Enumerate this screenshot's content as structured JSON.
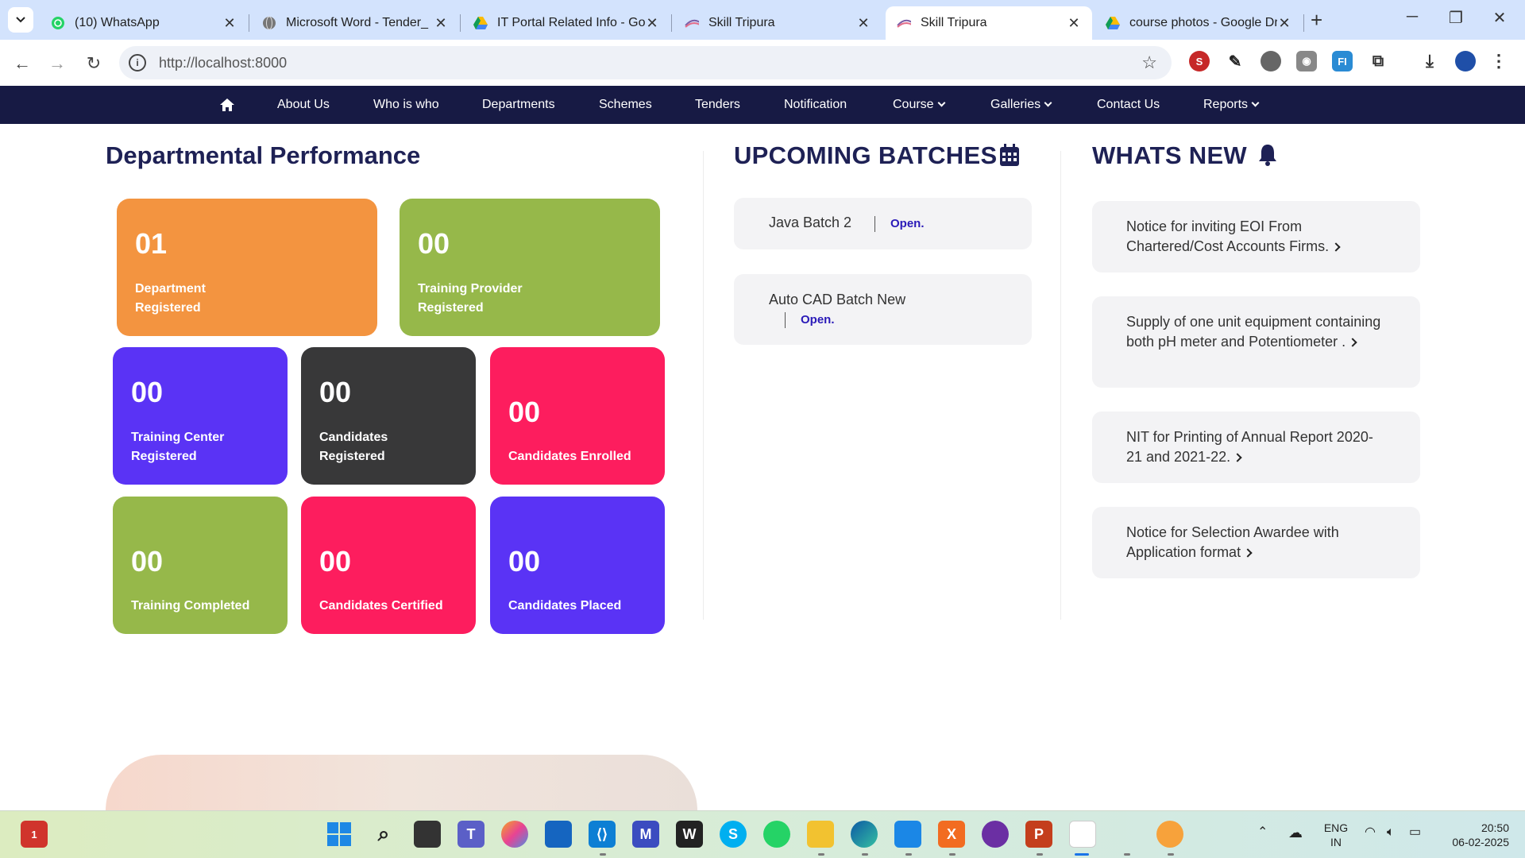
{
  "browser": {
    "tabs": [
      {
        "title": "(10) WhatsApp",
        "icon": "whatsapp-icon",
        "active": false
      },
      {
        "title": "Microsoft Word - Tender_",
        "icon": "globe-icon",
        "active": false
      },
      {
        "title": "IT Portal Related Info - Goo",
        "icon": "google-drive-icon",
        "active": false
      },
      {
        "title": "Skill Tripura",
        "icon": "skill-tripura-icon",
        "active": false
      },
      {
        "title": "Skill Tripura",
        "icon": "skill-tripura-icon",
        "active": true
      },
      {
        "title": "course photos - Google Dr",
        "icon": "google-drive-icon",
        "active": false
      }
    ],
    "url": "http://localhost:8000"
  },
  "nav": {
    "items": [
      "About Us",
      "Who is who",
      "Departments",
      "Schemes",
      "Tenders",
      "Notification",
      "Course",
      "Galleries",
      "Contact Us",
      "Reports"
    ]
  },
  "performance": {
    "title": "Departmental Performance",
    "stats": [
      {
        "num": "01",
        "label": "Department Registered",
        "color": "#f39440"
      },
      {
        "num": "00",
        "label": "Training Provider Registered",
        "color": "#96b84a"
      },
      {
        "num": "00",
        "label": "Training Center Registered",
        "color": "#5a33f5"
      },
      {
        "num": "00",
        "label": "Candidates Registered",
        "color": "#383839"
      },
      {
        "num": "00",
        "label": "Candidates Enrolled",
        "color": "#fd1d5e"
      },
      {
        "num": "00",
        "label": "Training Completed",
        "color": "#96b84a"
      },
      {
        "num": "00",
        "label": "Candidates Certified",
        "color": "#fd1d5e"
      },
      {
        "num": "00",
        "label": "Candidates Placed",
        "color": "#5a33f5"
      }
    ]
  },
  "batches": {
    "title": "UPCOMING BATCHES",
    "items": [
      {
        "name": "Java Batch 2",
        "status": "Open."
      },
      {
        "name": "Auto CAD Batch New",
        "status": "Open."
      }
    ]
  },
  "news": {
    "title": "WHATS NEW",
    "items": [
      "Notice for inviting EOI From Chartered/Cost Accounts Firms.",
      "Supply of one unit equipment containing both pH meter and Potentiometer .",
      "NIT for Printing of Annual Report 2020-21 and 2021-22.",
      "Notice for Selection Awardee with Application format"
    ]
  },
  "taskbar": {
    "badge": "1",
    "lang": "ENG",
    "region": "IN",
    "time": "20:50",
    "date": "06-02-2025"
  }
}
